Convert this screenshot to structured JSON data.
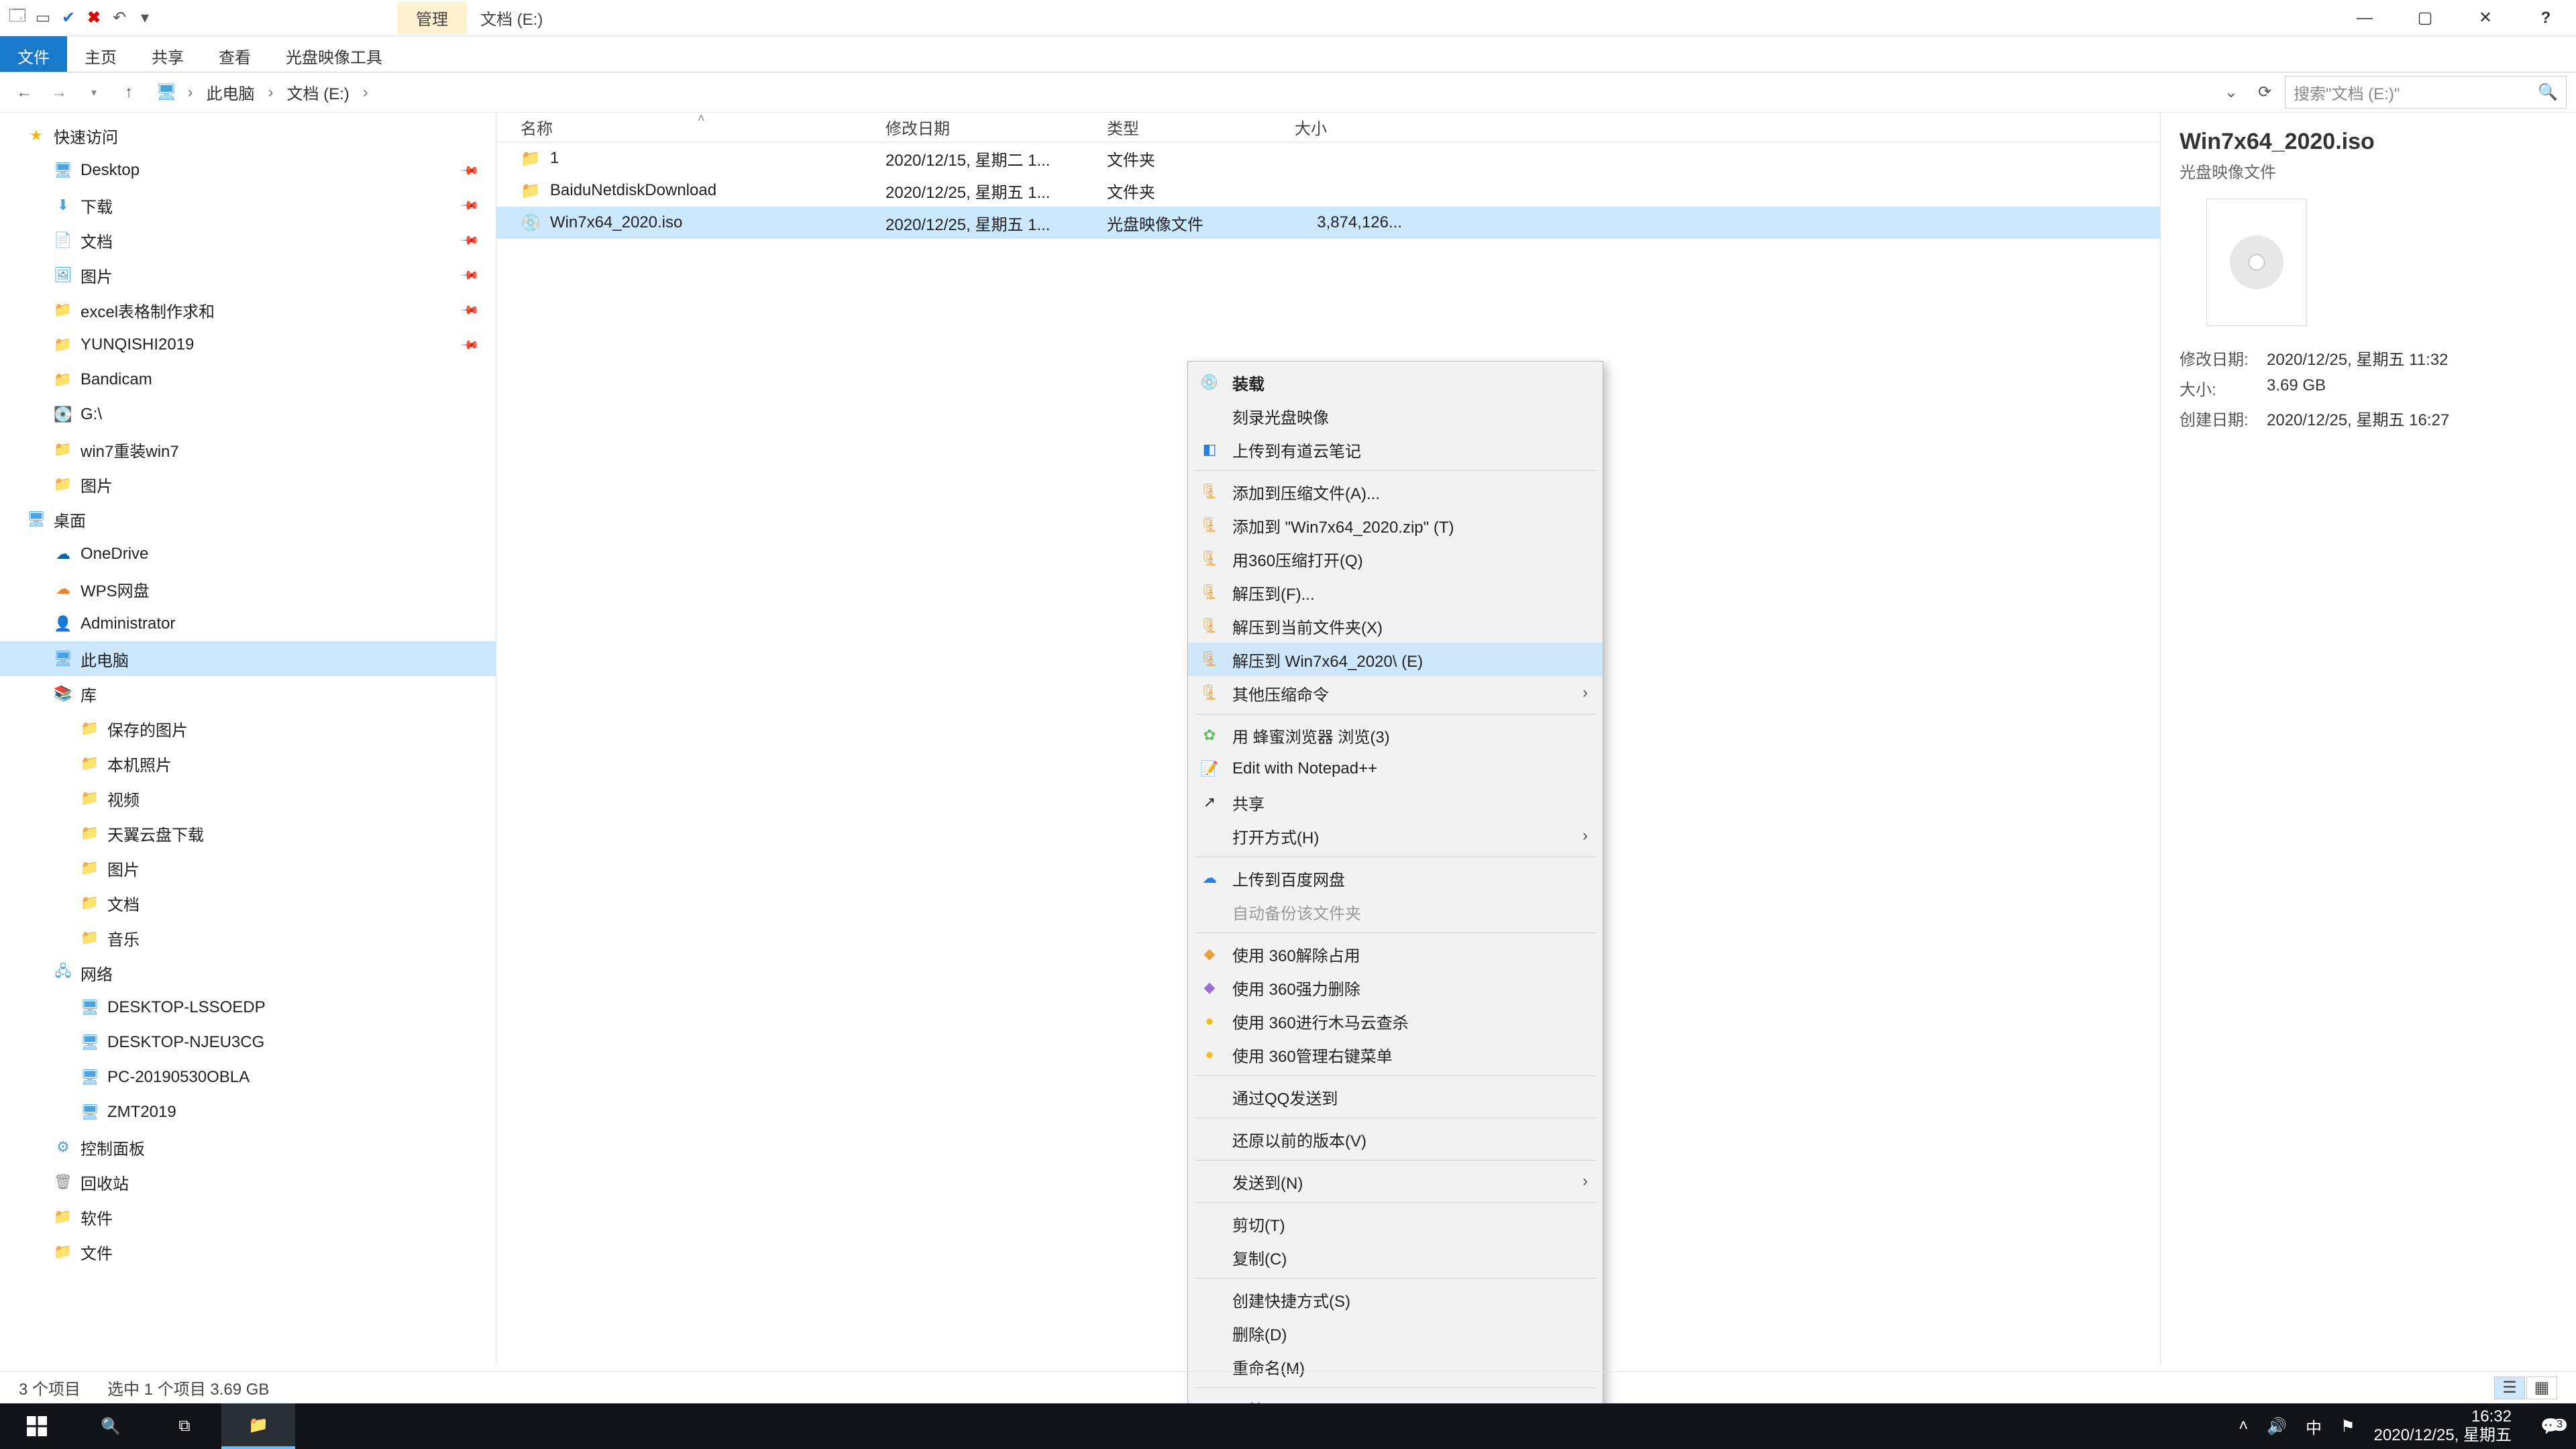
{
  "window": {
    "tab_context": "管理",
    "location_title": "文档 (E:)",
    "close": "✕"
  },
  "ribbon": {
    "file": "文件",
    "home": "主页",
    "share": "共享",
    "view": "查看",
    "disc_tools": "光盘映像工具"
  },
  "address": {
    "root": "此电脑",
    "current": "文档 (E:)",
    "search_placeholder": "搜索\"文档 (E:)\""
  },
  "tree": {
    "quick": "快速访问",
    "desktop": "Desktop",
    "downloads": "下载",
    "documents": "文档",
    "pictures_cn": "图片",
    "excel": "excel表格制作求和",
    "yunqishi": "YUNQISHI2019",
    "bandicam": "Bandicam",
    "gdrive": "G:\\",
    "win7re": "win7重装win7",
    "pictures2": "图片",
    "desktop_cn": "桌面",
    "onedrive": "OneDrive",
    "wps": "WPS网盘",
    "admin": "Administrator",
    "thispc": "此电脑",
    "libs": "库",
    "saved_pics": "保存的图片",
    "local_pics": "本机照片",
    "videos": "视频",
    "tianyi": "天翼云盘下载",
    "pics3": "图片",
    "docs2": "文档",
    "music": "音乐",
    "network": "网络",
    "pc1": "DESKTOP-LSSOEDP",
    "pc2": "DESKTOP-NJEU3CG",
    "pc3": "PC-20190530OBLA",
    "pc4": "ZMT2019",
    "cpanel": "控制面板",
    "recycle": "回收站",
    "soft": "软件",
    "files": "文件"
  },
  "cols": {
    "name": "名称",
    "date": "修改日期",
    "type": "类型",
    "size": "大小"
  },
  "rows": [
    {
      "name": "1",
      "date": "2020/12/15, 星期二 1...",
      "type": "文件夹",
      "size": ""
    },
    {
      "name": "BaiduNetdiskDownload",
      "date": "2020/12/25, 星期五 1...",
      "type": "文件夹",
      "size": ""
    },
    {
      "name": "Win7x64_2020.iso",
      "date": "2020/12/25, 星期五 1...",
      "type": "光盘映像文件",
      "size": "3,874,126..."
    }
  ],
  "menu": {
    "mount": "装载",
    "burn": "刻录光盘映像",
    "youdao": "上传到有道云笔记",
    "add_archive": "添加到压缩文件(A)...",
    "add_zip": "添加到 \"Win7x64_2020.zip\" (T)",
    "open_360zip": "用360压缩打开(Q)",
    "extract_to": "解压到(F)...",
    "extract_here": "解压到当前文件夹(X)",
    "extract_named": "解压到 Win7x64_2020\\ (E)",
    "other_zip": "其他压缩命令",
    "bee": "用 蜂蜜浏览器 浏览(3)",
    "npp": "Edit with Notepad++",
    "share": "共享",
    "open_with": "打开方式(H)",
    "baidu": "上传到百度网盘",
    "autobak": "自动备份该文件夹",
    "u360_unlock": "使用 360解除占用",
    "u360_force": "使用 360强力删除",
    "u360_scan": "使用 360进行木马云查杀",
    "u360_rcm": "使用 360管理右键菜单",
    "qq": "通过QQ发送到",
    "restore": "还原以前的版本(V)",
    "sendto": "发送到(N)",
    "cut": "剪切(T)",
    "copy": "复制(C)",
    "shortcut": "创建快捷方式(S)",
    "delete": "删除(D)",
    "rename": "重命名(M)",
    "props": "属性(R)"
  },
  "details": {
    "title": "Win7x64_2020.iso",
    "type": "光盘映像文件",
    "mdate_k": "修改日期:",
    "mdate_v": "2020/12/25, 星期五 11:32",
    "size_k": "大小:",
    "size_v": "3.69 GB",
    "cdate_k": "创建日期:",
    "cdate_v": "2020/12/25, 星期五 16:27"
  },
  "status": {
    "count": "3 个项目",
    "selected": "选中 1 个项目  3.69 GB"
  },
  "taskbar": {
    "ime": "中",
    "time": "16:32",
    "date": "2020/12/25, 星期五",
    "notif": "3"
  }
}
